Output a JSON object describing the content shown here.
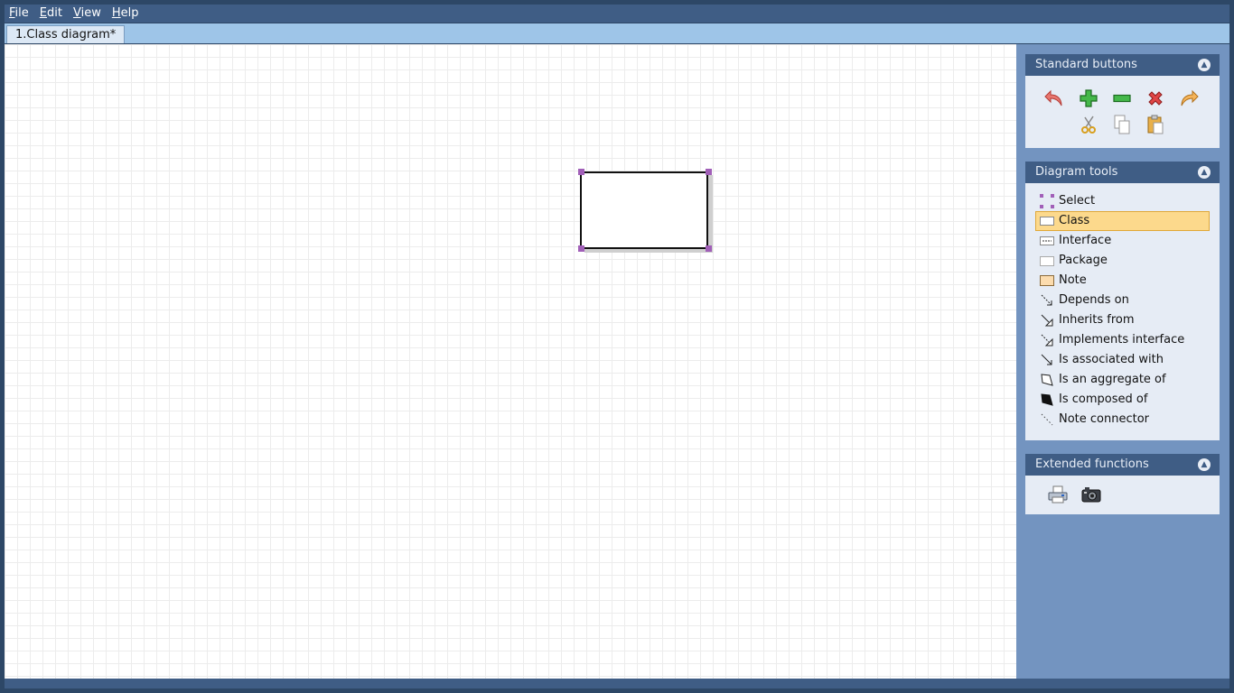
{
  "menu": {
    "file": {
      "acc": "F",
      "rest": "ile"
    },
    "edit": {
      "acc": "E",
      "rest": "dit"
    },
    "view": {
      "acc": "V",
      "rest": "iew"
    },
    "help": {
      "acc": "H",
      "rest": "elp"
    }
  },
  "tab": {
    "label": "1.Class diagram*"
  },
  "panels": {
    "standard": {
      "title": "Standard buttons",
      "buttons": [
        "undo-icon",
        "add-icon",
        "remove-icon",
        "delete-icon",
        "redo-icon",
        "cut-icon",
        "copy-icon",
        "paste-icon"
      ]
    },
    "diagram_tools": {
      "title": "Diagram tools",
      "items": [
        {
          "label": "Select",
          "icon": "select-icon"
        },
        {
          "label": "Class",
          "icon": "class-icon",
          "selected": true
        },
        {
          "label": "Interface",
          "icon": "interface-icon"
        },
        {
          "label": "Package",
          "icon": "package-icon"
        },
        {
          "label": "Note",
          "icon": "note-icon"
        },
        {
          "label": "Depends on",
          "icon": "depends-arrow-icon"
        },
        {
          "label": "Inherits from",
          "icon": "inherits-arrow-icon"
        },
        {
          "label": "Implements interface",
          "icon": "implements-arrow-icon"
        },
        {
          "label": "Is associated with",
          "icon": "association-arrow-icon"
        },
        {
          "label": "Is an aggregate of",
          "icon": "aggregation-diamond-icon"
        },
        {
          "label": "Is composed of",
          "icon": "composition-diamond-icon"
        },
        {
          "label": "Note connector",
          "icon": "note-connector-icon"
        }
      ]
    },
    "extended": {
      "title": "Extended functions",
      "buttons": [
        "print-icon",
        "camera-icon"
      ]
    }
  },
  "colors": {
    "selection_handle": "#a15fb8",
    "selected_tool_bg": "#fcd98c"
  }
}
